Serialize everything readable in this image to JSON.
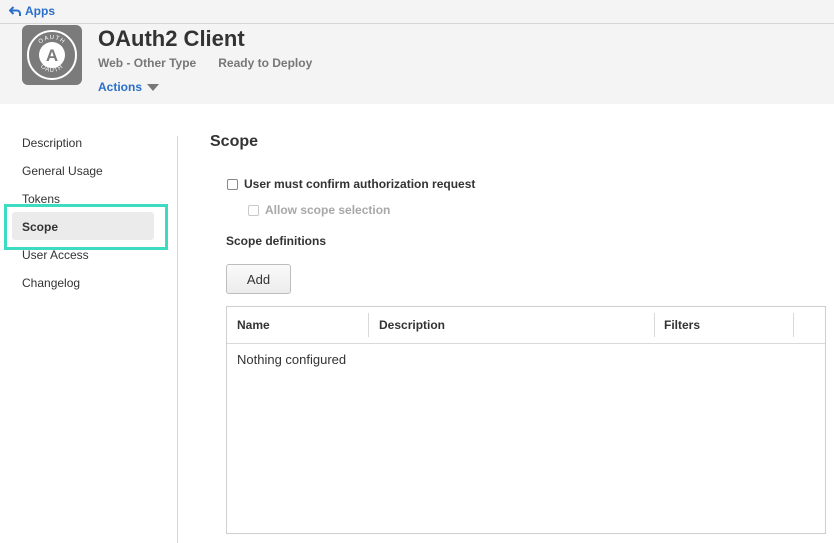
{
  "topbar": {
    "back_label": "Apps"
  },
  "header": {
    "title": "OAuth2 Client",
    "type": "Web - Other Type",
    "status": "Ready to Deploy",
    "actions_label": "Actions",
    "logo": {
      "top_text": "OAUTH",
      "bottom_text": "OAUTH",
      "letter": "A"
    }
  },
  "sidebar": {
    "items": [
      {
        "label": "Description"
      },
      {
        "label": "General Usage"
      },
      {
        "label": "Tokens"
      },
      {
        "label": "Scope"
      },
      {
        "label": "User Access"
      },
      {
        "label": "Changelog"
      }
    ],
    "active": "Scope"
  },
  "main": {
    "title": "Scope",
    "confirm_label": "User must confirm authorization request",
    "allow_scope_label": "Allow scope selection",
    "definitions_label": "Scope definitions",
    "add_label": "Add",
    "table": {
      "columns": [
        "Name",
        "Description",
        "Filters"
      ],
      "empty_text": "Nothing configured"
    }
  },
  "colors": {
    "accent": "#2a6fc9",
    "highlight": "#3ddbc1",
    "header_bg": "#f4f4f4"
  }
}
